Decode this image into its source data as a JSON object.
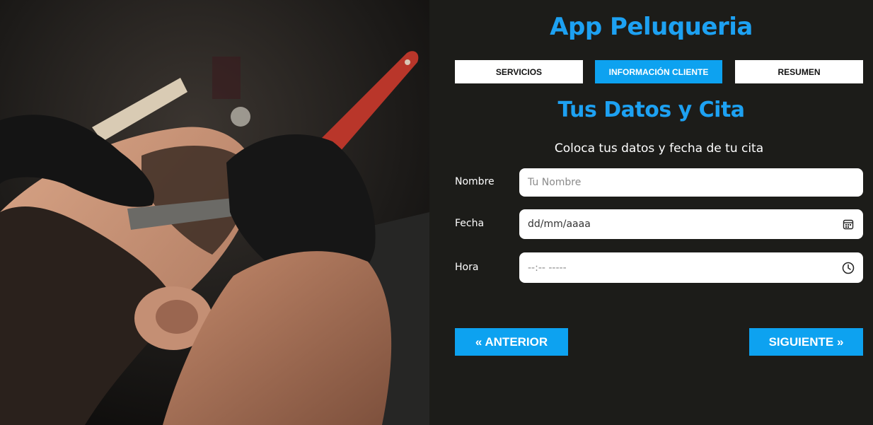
{
  "app": {
    "title": "App Peluqueria"
  },
  "tabs": [
    {
      "label": "SERVICIOS",
      "active": false
    },
    {
      "label": "INFORMACIÓN CLIENTE",
      "active": true
    },
    {
      "label": "RESUMEN",
      "active": false
    }
  ],
  "section": {
    "title": "Tus Datos y Cita",
    "subtitle": "Coloca tus datos y fecha de tu cita"
  },
  "form": {
    "nombre": {
      "label": "Nombre",
      "placeholder": "Tu Nombre"
    },
    "fecha": {
      "label": "Fecha",
      "value": "dd/mm/aaaa",
      "icon": "calendar-icon"
    },
    "hora": {
      "label": "Hora",
      "value": "--:-- -----",
      "icon": "clock-icon"
    }
  },
  "nav": {
    "prev_label": "« ANTERIOR",
    "next_label": "SIGUIENTE »"
  },
  "colors": {
    "accent": "#0da2f0",
    "background": "#1c1c19",
    "text": "#ffffff"
  }
}
